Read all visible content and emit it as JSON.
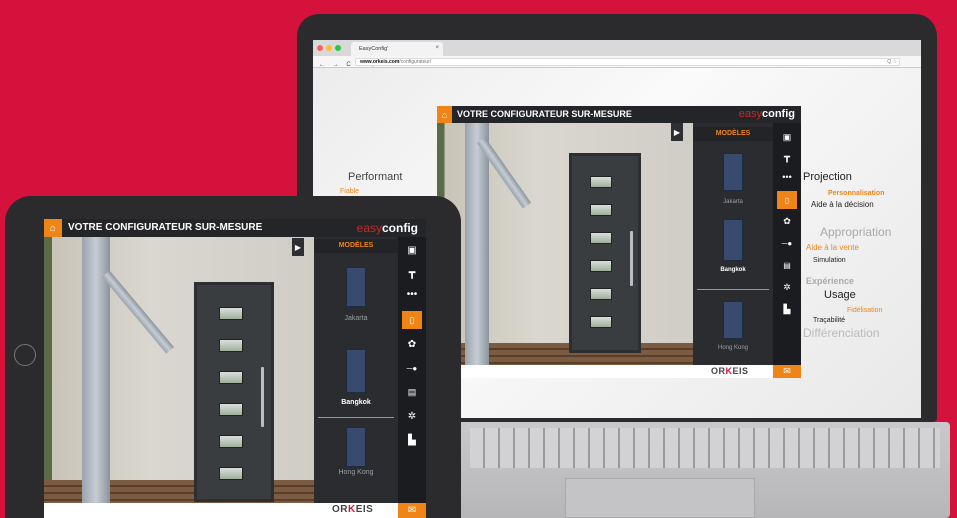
{
  "browser": {
    "tab_title": "EasyConfig'",
    "tab_close": "×",
    "nav": "← → C ⌂ ⓘ",
    "url_host": "www.orkeis.com",
    "url_path": "/configurateur/",
    "url_tools": "Q ☆"
  },
  "app": {
    "title": "VOTRE CONFIGURATEUR SUR-MESURE",
    "brand_easy": "easy",
    "brand_config": "config",
    "models_title": "MODÈLES",
    "models": [
      {
        "name": "Jakarta",
        "selected": false
      },
      {
        "name": "Bangkok",
        "selected": true
      },
      {
        "name": "Hong Kong",
        "selected": false
      }
    ],
    "toolbar_icons": [
      "image-icon",
      "handle-icon",
      "dots-icon",
      "door-icon",
      "palette-icon",
      "slider-icon",
      "document-icon",
      "settings-icon",
      "save-icon"
    ],
    "footer_logo_pre": "OR",
    "footer_logo_accent": "K",
    "footer_logo_post": "EIS",
    "colors": {
      "accent": "#ef8417",
      "background": "#d5123c",
      "header": "#232528"
    }
  },
  "claims": {
    "performant": "Performant",
    "fiable": "Fiable",
    "projection": "Projection",
    "personnalisation": "Personnalisation",
    "aide_decision": "Aide à la décision",
    "appropriation": "Appropriation",
    "aide_vente": "Aide à la vente",
    "simulation": "Simulation",
    "experience": "Expérience",
    "usage": "Usage",
    "fidelisation": "Fidélisation",
    "tracabilite": "Traçabilité",
    "differenciation": "Différenciation"
  }
}
